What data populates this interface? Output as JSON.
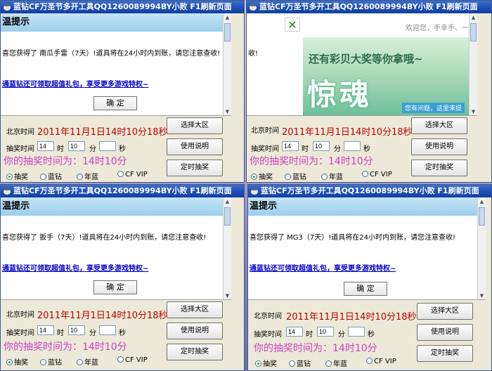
{
  "windows": [
    {
      "title": "蓝钻CF万圣节多开工具QQ1260089994BY小败 F1刷新页面",
      "browser": {
        "variant": "prompt",
        "header": "温提示",
        "message": "喜您获得了 南瓜手雷（7天）!道具将在24小时内到账，请您注意查收!",
        "link": "通蓝钻还可领取超值礼包，享受更多游戏特权~",
        "ok_label": "确 定"
      },
      "beijing_label": "北京时间",
      "beijing_time": "2011年11月1日14时10分18秒",
      "draw_label": "抽奖时间",
      "hour_value": "14",
      "hour_unit": "时",
      "minute_value": "10",
      "minute_unit": "分",
      "second_value": "",
      "second_unit": "秒",
      "draw_time_text": "你的抽奖时间为：14时10分",
      "radios": [
        {
          "label": "抽奖",
          "checked": true
        },
        {
          "label": "蓝钻",
          "checked": false
        },
        {
          "label": "年蓝",
          "checked": false
        },
        {
          "label": "CF VIP",
          "checked": false
        }
      ],
      "buttons": {
        "region": "选择大区",
        "help": "使用说明",
        "timed": "定时抽奖"
      }
    },
    {
      "title": "蓝钻CF万圣节多开工具QQ1260089994BY小败 F1刷新页面",
      "browser": {
        "variant": "ad",
        "close_glyph": "✕",
        "greeting": "欢迎您，手幸手、一",
        "message": "收!",
        "banner_line1": "还有彩贝大奖等你拿哦~",
        "banner_big": "惊魂",
        "banner_tip": "您有问题，这里来提"
      },
      "beijing_label": "北京时间",
      "beijing_time": "2011年11月1日14时10分18秒",
      "draw_label": "抽奖时间",
      "hour_value": "14",
      "hour_unit": "时",
      "minute_value": "10",
      "minute_unit": "分",
      "second_value": "",
      "second_unit": "秒",
      "draw_time_text": "你的抽奖时间为：14时10分",
      "radios": [
        {
          "label": "抽奖",
          "checked": true
        },
        {
          "label": "蓝钻",
          "checked": false
        },
        {
          "label": "年蓝",
          "checked": false
        },
        {
          "label": "CF VIP",
          "checked": false
        }
      ],
      "buttons": {
        "region": "选择大区",
        "help": "使用说明",
        "timed": "定时抽奖"
      }
    },
    {
      "title": "蓝钻CF万圣节多开工具QQ1260089994BY小败 F1刷新页面",
      "browser": {
        "variant": "prompt",
        "header": "温提示",
        "message": "喜您获得了 扳手（7天）!道具将在24小时内到账，请您注意查收!",
        "link": "通蓝钻还可领取超值礼包，享受更多游戏特权~",
        "ok_label": "确 定"
      },
      "beijing_label": "北京时间",
      "beijing_time": "2011年11月1日14时10分18秒",
      "draw_label": "抽奖时间",
      "hour_value": "14",
      "hour_unit": "时",
      "minute_value": "10",
      "minute_unit": "分",
      "second_value": "",
      "second_unit": "秒",
      "draw_time_text": "你的抽奖时间为：14时10分",
      "radios": [
        {
          "label": "抽奖",
          "checked": true
        },
        {
          "label": "蓝钻",
          "checked": false
        },
        {
          "label": "年蓝",
          "checked": false
        },
        {
          "label": "CF VIP",
          "checked": false
        }
      ],
      "buttons": {
        "region": "选择大区",
        "help": "使用说明",
        "timed": "定时抽奖"
      }
    },
    {
      "title": "蓝钻CF万圣节多开工具QQ1260089994BY小败 F1刷新页面",
      "browser": {
        "variant": "prompt",
        "header": "温提示",
        "message": "喜您获得了 MG3（7天）!道具将在24小时内到账，请您注意查收!",
        "link": "通蓝钻还可领取超值礼包，享受更多游戏特权~",
        "ok_label": "确 定"
      },
      "beijing_label": "北京时间",
      "beijing_time": "2011年11月1日14时10分18秒",
      "draw_label": "抽奖时间",
      "hour_value": "14",
      "hour_unit": "时",
      "minute_value": "10",
      "minute_unit": "分",
      "second_value": "",
      "second_unit": "秒",
      "draw_time_text": "你的抽奖时间为：14时10分",
      "radios": [
        {
          "label": "抽奖",
          "checked": true
        },
        {
          "label": "蓝钻",
          "checked": false
        },
        {
          "label": "年蓝",
          "checked": false
        },
        {
          "label": "CF VIP",
          "checked": false
        }
      ],
      "buttons": {
        "region": "选择大区",
        "help": "使用说明",
        "timed": "定时抽奖"
      }
    }
  ]
}
